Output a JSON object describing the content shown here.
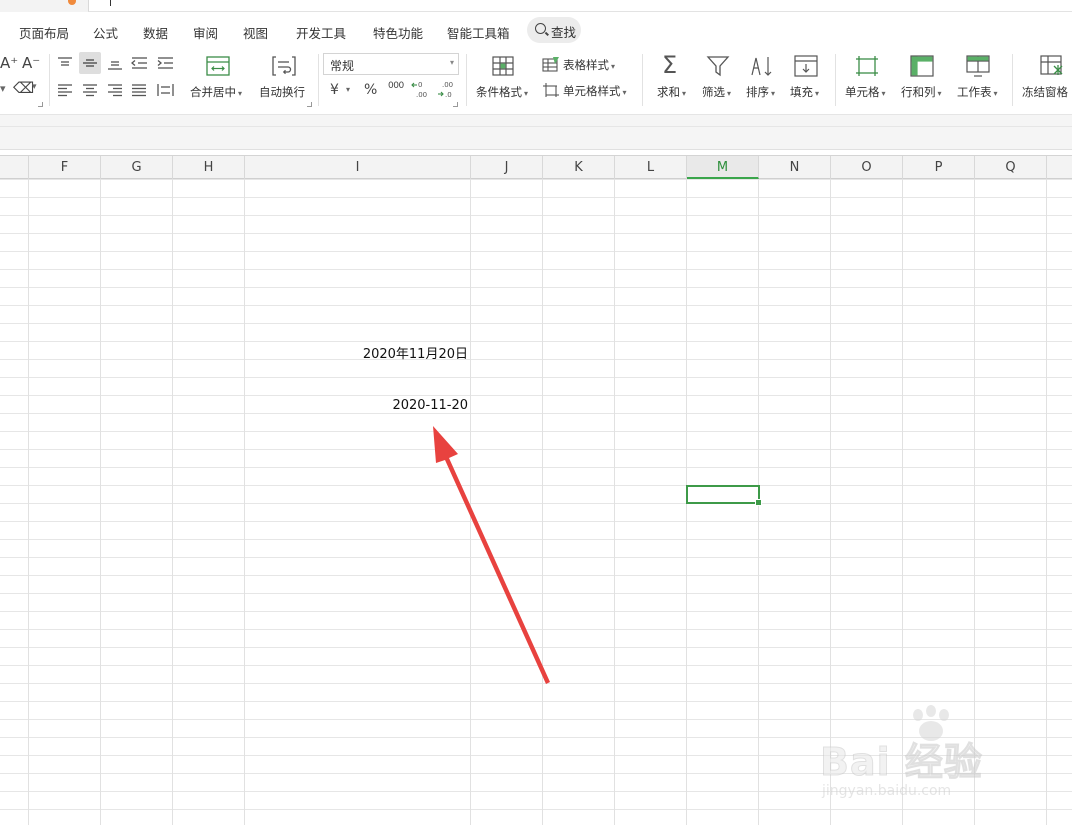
{
  "menu": {
    "tabs": [
      {
        "label": "页面布局"
      },
      {
        "label": "公式"
      },
      {
        "label": "数据"
      },
      {
        "label": "审阅"
      },
      {
        "label": "视图"
      },
      {
        "label": "开发工具"
      },
      {
        "label": "特色功能"
      },
      {
        "label": "智能工具箱"
      }
    ],
    "search_label": "查找"
  },
  "ribbon": {
    "font_grow": "A⁺",
    "font_shrink": "A⁻",
    "merge_center": "合并居中",
    "wrap_text": "自动换行",
    "number_format": "常规",
    "currency_symbol": "¥",
    "percent_symbol": "%",
    "thousands_symbol": "000",
    "cond_format": "条件格式",
    "table_style": "表格样式",
    "cell_style": "单元格样式",
    "sum": "求和",
    "filter": "筛选",
    "sort": "排序",
    "fill": "填充",
    "cell": "单元格",
    "row_col": "行和列",
    "worksheet": "工作表",
    "freeze": "冻结窗格"
  },
  "sheet": {
    "columns": [
      "F",
      "G",
      "H",
      "I",
      "J",
      "K",
      "L",
      "M",
      "N",
      "O",
      "P",
      "Q"
    ],
    "active_column": "M",
    "cells": {
      "i_date_cn": "2020年11月20日",
      "i_date_iso": "2020-11-20"
    }
  },
  "colors": {
    "accent_green": "#3d9a48",
    "arrow_red": "#e8423f"
  },
  "watermark": {
    "brand": "Bai 经验",
    "url": "jingyan.baidu.com"
  }
}
